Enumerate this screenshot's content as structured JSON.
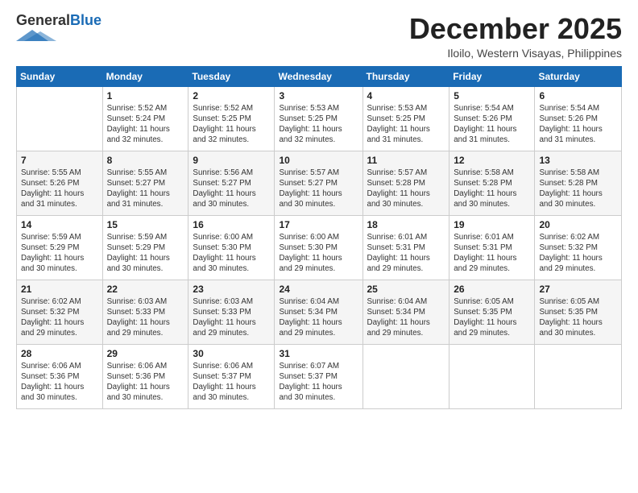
{
  "header": {
    "logo_general": "General",
    "logo_blue": "Blue",
    "month_title": "December 2025",
    "location": "Iloilo, Western Visayas, Philippines"
  },
  "weekdays": [
    "Sunday",
    "Monday",
    "Tuesday",
    "Wednesday",
    "Thursday",
    "Friday",
    "Saturday"
  ],
  "weeks": [
    [
      {
        "day": "",
        "info": ""
      },
      {
        "day": "1",
        "info": "Sunrise: 5:52 AM\nSunset: 5:24 PM\nDaylight: 11 hours\nand 32 minutes."
      },
      {
        "day": "2",
        "info": "Sunrise: 5:52 AM\nSunset: 5:25 PM\nDaylight: 11 hours\nand 32 minutes."
      },
      {
        "day": "3",
        "info": "Sunrise: 5:53 AM\nSunset: 5:25 PM\nDaylight: 11 hours\nand 32 minutes."
      },
      {
        "day": "4",
        "info": "Sunrise: 5:53 AM\nSunset: 5:25 PM\nDaylight: 11 hours\nand 31 minutes."
      },
      {
        "day": "5",
        "info": "Sunrise: 5:54 AM\nSunset: 5:26 PM\nDaylight: 11 hours\nand 31 minutes."
      },
      {
        "day": "6",
        "info": "Sunrise: 5:54 AM\nSunset: 5:26 PM\nDaylight: 11 hours\nand 31 minutes."
      }
    ],
    [
      {
        "day": "7",
        "info": "Sunrise: 5:55 AM\nSunset: 5:26 PM\nDaylight: 11 hours\nand 31 minutes."
      },
      {
        "day": "8",
        "info": "Sunrise: 5:55 AM\nSunset: 5:27 PM\nDaylight: 11 hours\nand 31 minutes."
      },
      {
        "day": "9",
        "info": "Sunrise: 5:56 AM\nSunset: 5:27 PM\nDaylight: 11 hours\nand 30 minutes."
      },
      {
        "day": "10",
        "info": "Sunrise: 5:57 AM\nSunset: 5:27 PM\nDaylight: 11 hours\nand 30 minutes."
      },
      {
        "day": "11",
        "info": "Sunrise: 5:57 AM\nSunset: 5:28 PM\nDaylight: 11 hours\nand 30 minutes."
      },
      {
        "day": "12",
        "info": "Sunrise: 5:58 AM\nSunset: 5:28 PM\nDaylight: 11 hours\nand 30 minutes."
      },
      {
        "day": "13",
        "info": "Sunrise: 5:58 AM\nSunset: 5:28 PM\nDaylight: 11 hours\nand 30 minutes."
      }
    ],
    [
      {
        "day": "14",
        "info": "Sunrise: 5:59 AM\nSunset: 5:29 PM\nDaylight: 11 hours\nand 30 minutes."
      },
      {
        "day": "15",
        "info": "Sunrise: 5:59 AM\nSunset: 5:29 PM\nDaylight: 11 hours\nand 30 minutes."
      },
      {
        "day": "16",
        "info": "Sunrise: 6:00 AM\nSunset: 5:30 PM\nDaylight: 11 hours\nand 30 minutes."
      },
      {
        "day": "17",
        "info": "Sunrise: 6:00 AM\nSunset: 5:30 PM\nDaylight: 11 hours\nand 29 minutes."
      },
      {
        "day": "18",
        "info": "Sunrise: 6:01 AM\nSunset: 5:31 PM\nDaylight: 11 hours\nand 29 minutes."
      },
      {
        "day": "19",
        "info": "Sunrise: 6:01 AM\nSunset: 5:31 PM\nDaylight: 11 hours\nand 29 minutes."
      },
      {
        "day": "20",
        "info": "Sunrise: 6:02 AM\nSunset: 5:32 PM\nDaylight: 11 hours\nand 29 minutes."
      }
    ],
    [
      {
        "day": "21",
        "info": "Sunrise: 6:02 AM\nSunset: 5:32 PM\nDaylight: 11 hours\nand 29 minutes."
      },
      {
        "day": "22",
        "info": "Sunrise: 6:03 AM\nSunset: 5:33 PM\nDaylight: 11 hours\nand 29 minutes."
      },
      {
        "day": "23",
        "info": "Sunrise: 6:03 AM\nSunset: 5:33 PM\nDaylight: 11 hours\nand 29 minutes."
      },
      {
        "day": "24",
        "info": "Sunrise: 6:04 AM\nSunset: 5:34 PM\nDaylight: 11 hours\nand 29 minutes."
      },
      {
        "day": "25",
        "info": "Sunrise: 6:04 AM\nSunset: 5:34 PM\nDaylight: 11 hours\nand 29 minutes."
      },
      {
        "day": "26",
        "info": "Sunrise: 6:05 AM\nSunset: 5:35 PM\nDaylight: 11 hours\nand 29 minutes."
      },
      {
        "day": "27",
        "info": "Sunrise: 6:05 AM\nSunset: 5:35 PM\nDaylight: 11 hours\nand 30 minutes."
      }
    ],
    [
      {
        "day": "28",
        "info": "Sunrise: 6:06 AM\nSunset: 5:36 PM\nDaylight: 11 hours\nand 30 minutes."
      },
      {
        "day": "29",
        "info": "Sunrise: 6:06 AM\nSunset: 5:36 PM\nDaylight: 11 hours\nand 30 minutes."
      },
      {
        "day": "30",
        "info": "Sunrise: 6:06 AM\nSunset: 5:37 PM\nDaylight: 11 hours\nand 30 minutes."
      },
      {
        "day": "31",
        "info": "Sunrise: 6:07 AM\nSunset: 5:37 PM\nDaylight: 11 hours\nand 30 minutes."
      },
      {
        "day": "",
        "info": ""
      },
      {
        "day": "",
        "info": ""
      },
      {
        "day": "",
        "info": ""
      }
    ]
  ]
}
